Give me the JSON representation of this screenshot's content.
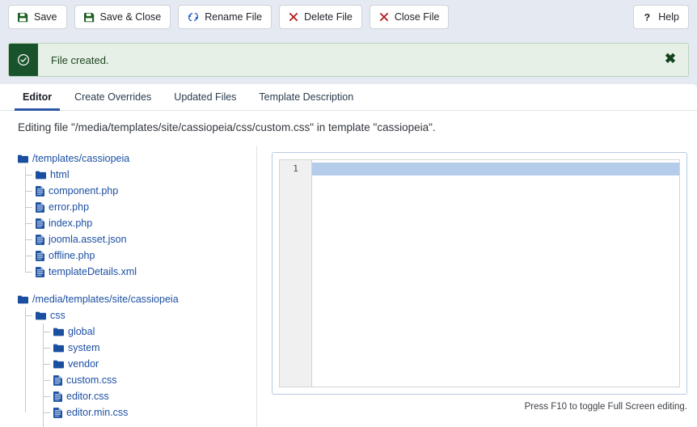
{
  "toolbar": {
    "buttons": [
      {
        "label": "Save",
        "icon": "save-floppy-icon"
      },
      {
        "label": "Save & Close",
        "icon": "save-floppy-icon"
      },
      {
        "label": "Rename File",
        "icon": "refresh-sync-icon"
      },
      {
        "label": "Delete File",
        "icon": "x-mark-icon"
      },
      {
        "label": "Close File",
        "icon": "x-mark-icon"
      }
    ],
    "help": {
      "label": "Help",
      "icon": "question-mark-icon"
    }
  },
  "alert": {
    "message": "File created.",
    "icon": "check-circle-icon",
    "close_label": "✖",
    "accent_color": "#18532b",
    "background_color": "#e6f0e6"
  },
  "tabs": [
    {
      "label": "Editor",
      "active": true
    },
    {
      "label": "Create Overrides",
      "active": false
    },
    {
      "label": "Updated Files",
      "active": false
    },
    {
      "label": "Template Description",
      "active": false
    }
  ],
  "editing_notice": "Editing file \"/media/templates/site/cassiopeia/css/custom.css\" in template \"cassiopeia\".",
  "tree": {
    "groups": [
      {
        "root": {
          "label": "/templates/cassiopeia",
          "icon": "folder-icon",
          "depth": 0
        },
        "nodes": [
          {
            "label": "html",
            "icon": "folder-icon",
            "depth": 1
          },
          {
            "label": "component.php",
            "icon": "file-icon",
            "depth": 1
          },
          {
            "label": "error.php",
            "icon": "file-icon",
            "depth": 1
          },
          {
            "label": "index.php",
            "icon": "file-icon",
            "depth": 1
          },
          {
            "label": "joomla.asset.json",
            "icon": "file-icon",
            "depth": 1
          },
          {
            "label": "offline.php",
            "icon": "file-icon",
            "depth": 1
          },
          {
            "label": "templateDetails.xml",
            "icon": "file-icon",
            "depth": 1
          }
        ]
      },
      {
        "root": {
          "label": "/media/templates/site/cassiopeia",
          "icon": "folder-icon",
          "depth": 0
        },
        "nodes": [
          {
            "label": "css",
            "icon": "folder-icon",
            "depth": 1
          },
          {
            "label": "global",
            "icon": "folder-icon",
            "depth": 2
          },
          {
            "label": "system",
            "icon": "folder-icon",
            "depth": 2
          },
          {
            "label": "vendor",
            "icon": "folder-icon",
            "depth": 2
          },
          {
            "label": "custom.css",
            "icon": "file-icon",
            "depth": 2
          },
          {
            "label": "editor.css",
            "icon": "file-icon",
            "depth": 2
          },
          {
            "label": "editor.min.css",
            "icon": "file-icon",
            "depth": 2
          }
        ]
      }
    ],
    "link_color": "#1c4fa3"
  },
  "editor": {
    "line_numbers": [
      "1"
    ],
    "content": "",
    "active_line": 1,
    "hint": "Press F10 to toggle Full Screen editing.",
    "highlight_color": "#b4ccea"
  }
}
